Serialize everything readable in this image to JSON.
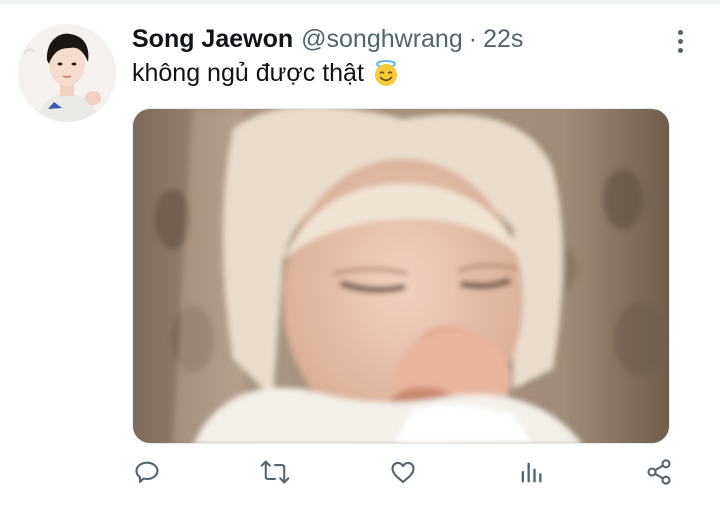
{
  "tweet": {
    "author_name": "Song Jaewon",
    "handle": "@songhwrang",
    "separator": "·",
    "time": "22s",
    "text": "không ngủ được thật"
  },
  "icons": {
    "emoji": "halo-smiling-face-icon",
    "more": "more-vertical-icon",
    "reply": "reply-icon",
    "retweet": "retweet-icon",
    "like": "heart-icon",
    "analytics": "analytics-icon",
    "share": "share-icon"
  },
  "colors": {
    "name": "#0f1419",
    "secondary": "#536471",
    "icon": "#536471",
    "divider": "#eff3f4"
  }
}
